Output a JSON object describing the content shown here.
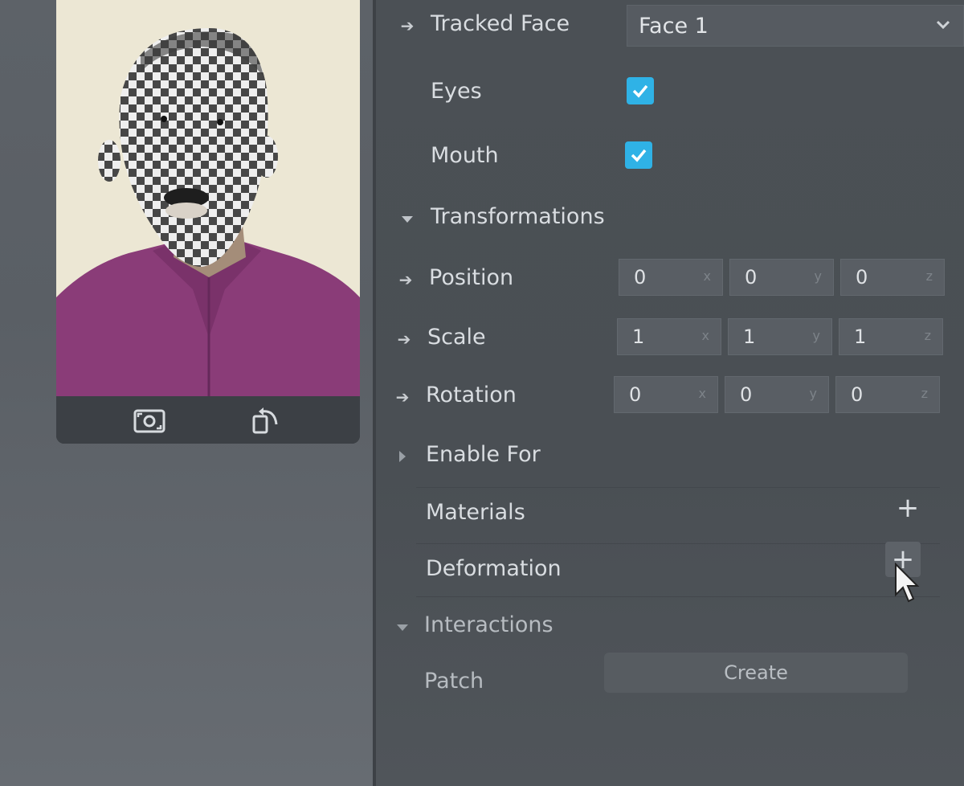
{
  "preview": {
    "camera_switch_icon": "camera-switch-icon",
    "rotate_icon": "rotate-icon"
  },
  "properties": {
    "tracked_face": {
      "label": "Tracked Face",
      "value": "Face 1"
    },
    "eyes": {
      "label": "Eyes",
      "checked": true
    },
    "mouth": {
      "label": "Mouth",
      "checked": true
    },
    "transformations": {
      "label": "Transformations"
    },
    "position": {
      "label": "Position",
      "x": "0",
      "y": "0",
      "z": "0"
    },
    "scale": {
      "label": "Scale",
      "x": "1",
      "y": "1",
      "z": "1"
    },
    "rotation": {
      "label": "Rotation",
      "x": "0",
      "y": "0",
      "z": "0"
    },
    "enable_for": {
      "label": "Enable For"
    },
    "materials": {
      "label": "Materials",
      "add": "+"
    },
    "deformation": {
      "label": "Deformation",
      "add": "+"
    },
    "interactions": {
      "label": "Interactions"
    },
    "patch": {
      "label": "Patch",
      "button": "Create"
    }
  },
  "axes": {
    "x": "x",
    "y": "y",
    "z": "z"
  },
  "colors": {
    "accent": "#2fb2e6",
    "panel": "#4a4f54"
  }
}
